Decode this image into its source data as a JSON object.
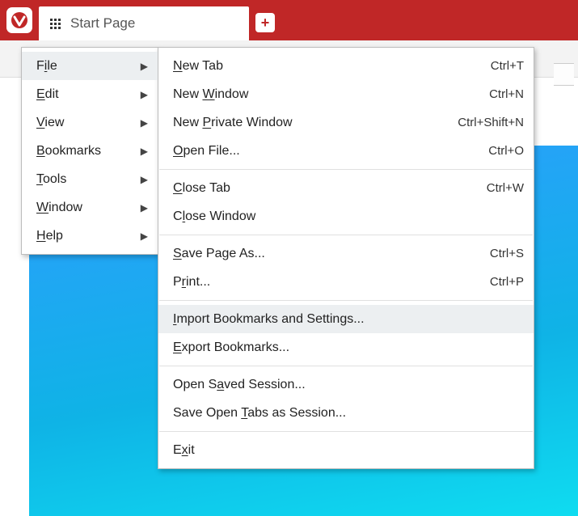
{
  "tab_title": "Start Page",
  "main_menu": [
    {
      "pre": "F",
      "u": "i",
      "post": "le",
      "hover": true
    },
    {
      "pre": "",
      "u": "E",
      "post": "dit"
    },
    {
      "pre": "",
      "u": "V",
      "post": "iew"
    },
    {
      "pre": "",
      "u": "B",
      "post": "ookmarks"
    },
    {
      "pre": "",
      "u": "T",
      "post": "ools"
    },
    {
      "pre": "",
      "u": "W",
      "post": "indow"
    },
    {
      "pre": "",
      "u": "H",
      "post": "elp"
    }
  ],
  "file_menu": [
    {
      "type": "item",
      "pre": "",
      "u": "N",
      "post": "ew Tab",
      "shortcut": "Ctrl+T"
    },
    {
      "type": "item",
      "pre": "New ",
      "u": "W",
      "post": "indow",
      "shortcut": "Ctrl+N"
    },
    {
      "type": "item",
      "pre": "New ",
      "u": "P",
      "post": "rivate Window",
      "shortcut": "Ctrl+Shift+N"
    },
    {
      "type": "item",
      "pre": "",
      "u": "O",
      "post": "pen File...",
      "shortcut": "Ctrl+O"
    },
    {
      "type": "sep"
    },
    {
      "type": "item",
      "pre": "",
      "u": "C",
      "post": "lose Tab",
      "shortcut": "Ctrl+W"
    },
    {
      "type": "item",
      "pre": "C",
      "u": "l",
      "post": "ose Window",
      "shortcut": ""
    },
    {
      "type": "sep"
    },
    {
      "type": "item",
      "pre": "",
      "u": "S",
      "post": "ave Page As...",
      "shortcut": "Ctrl+S"
    },
    {
      "type": "item",
      "pre": "P",
      "u": "r",
      "post": "int...",
      "shortcut": "Ctrl+P"
    },
    {
      "type": "sep"
    },
    {
      "type": "item",
      "pre": "",
      "u": "I",
      "post": "mport Bookmarks and Settings...",
      "shortcut": "",
      "hover": true
    },
    {
      "type": "item",
      "pre": "",
      "u": "E",
      "post": "xport Bookmarks...",
      "shortcut": ""
    },
    {
      "type": "sep"
    },
    {
      "type": "item",
      "pre": "Open S",
      "u": "a",
      "post": "ved Session...",
      "shortcut": ""
    },
    {
      "type": "item",
      "pre": "Save Open ",
      "u": "T",
      "post": "abs as Session...",
      "shortcut": ""
    },
    {
      "type": "sep"
    },
    {
      "type": "item",
      "pre": "E",
      "u": "x",
      "post": "it",
      "shortcut": ""
    }
  ]
}
